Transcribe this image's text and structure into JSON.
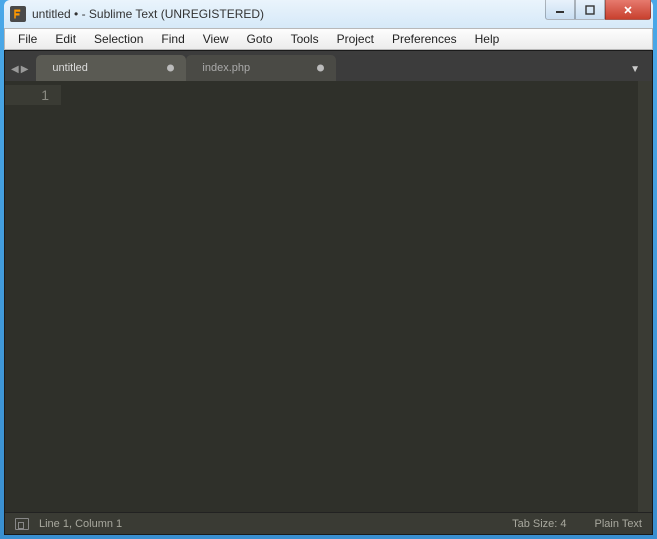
{
  "window": {
    "title": "untitled • - Sublime Text (UNREGISTERED)"
  },
  "menubar": {
    "items": [
      "File",
      "Edit",
      "Selection",
      "Find",
      "View",
      "Goto",
      "Tools",
      "Project",
      "Preferences",
      "Help"
    ]
  },
  "tabs": [
    {
      "label": "untitled",
      "dirty": true,
      "active": true
    },
    {
      "label": "index.php",
      "dirty": true,
      "active": false
    }
  ],
  "editor": {
    "line_numbers": [
      "1"
    ]
  },
  "statusbar": {
    "position": "Line 1, Column 1",
    "tab_size": "Tab Size: 4",
    "syntax": "Plain Text"
  }
}
